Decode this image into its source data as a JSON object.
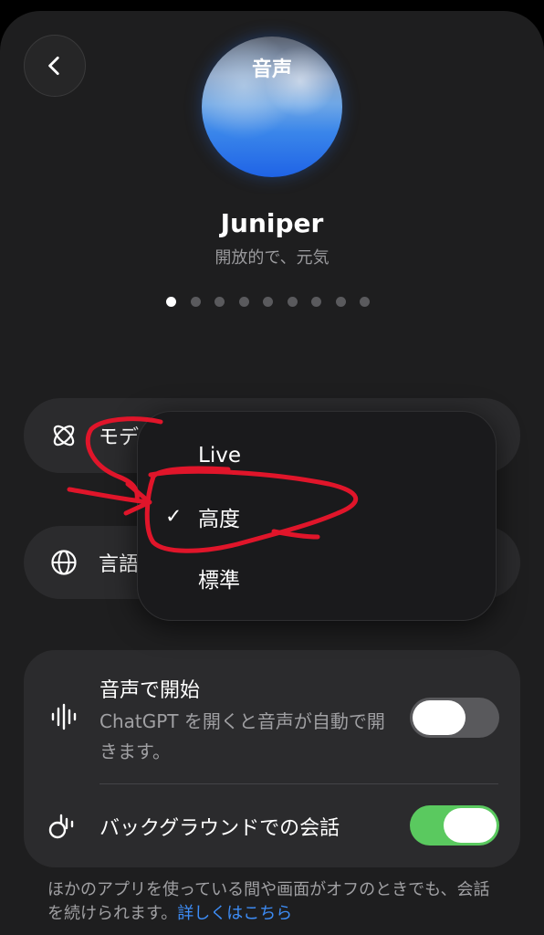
{
  "header": {
    "title": "音声",
    "back_icon": "chevron-left-icon"
  },
  "voice": {
    "name": "Juniper",
    "description": "開放的で、元気",
    "page_count": 9,
    "active_page": 1
  },
  "rows": {
    "model": {
      "label": "モデ",
      "icon": "atom-icon"
    },
    "language": {
      "label": "言語",
      "icon": "globe-icon"
    }
  },
  "model_menu": {
    "items": [
      {
        "label": "Live",
        "selected": false
      },
      {
        "label": "高度",
        "selected": true
      },
      {
        "label": "標準",
        "selected": false
      }
    ],
    "check_glyph": "✓"
  },
  "settings": {
    "start_with_voice": {
      "title": "音声で開始",
      "description": "ChatGPT を開くと音声が自動で開きます。",
      "enabled": false,
      "icon": "waveform-icon"
    },
    "background_conversation": {
      "title": "バックグラウンドでの会話",
      "enabled": true,
      "icon": "background-voice-icon"
    }
  },
  "footer": {
    "text": "ほかのアプリを使っている間や画面がオフのときでも、会話を続けられます。",
    "link": "詳しくはこちら"
  },
  "colors": {
    "toggle_on": "#5ac95f",
    "link": "#3d8cf5",
    "annotation": "#e0152a"
  }
}
